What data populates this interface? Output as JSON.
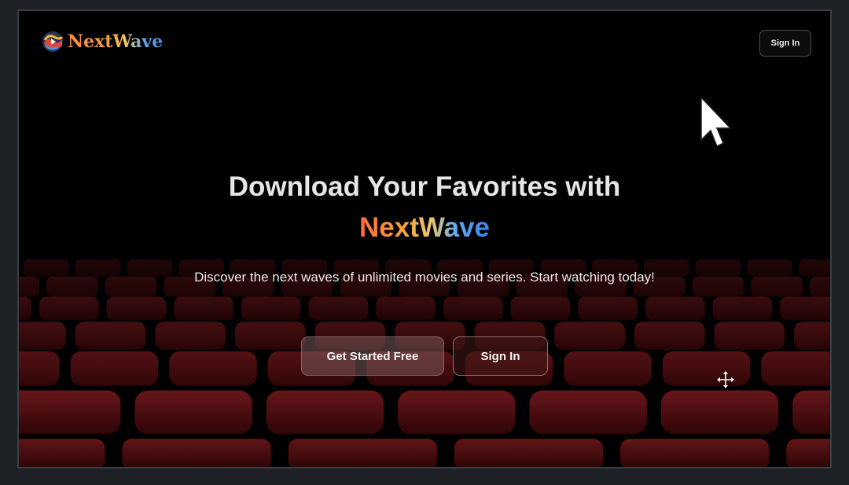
{
  "header": {
    "logo_text": "NextWave",
    "signin_label": "Sign In"
  },
  "hero": {
    "title": "Download Your Favorites with",
    "brand": "NextWave",
    "subtitle": "Discover the next waves of unlimited movies and series. Start watching today!"
  },
  "cta": {
    "primary_label": "Get Started Free",
    "secondary_label": "Sign In"
  },
  "icons": {
    "logo": "wave-logo-icon",
    "pointer": "mouse-pointer-icon",
    "move": "move-cursor-icon"
  },
  "colors": {
    "background": "#000000",
    "seat": "#5a0f12",
    "brand_orange": "#f6a33c",
    "brand_blue": "#4d8fe6"
  }
}
